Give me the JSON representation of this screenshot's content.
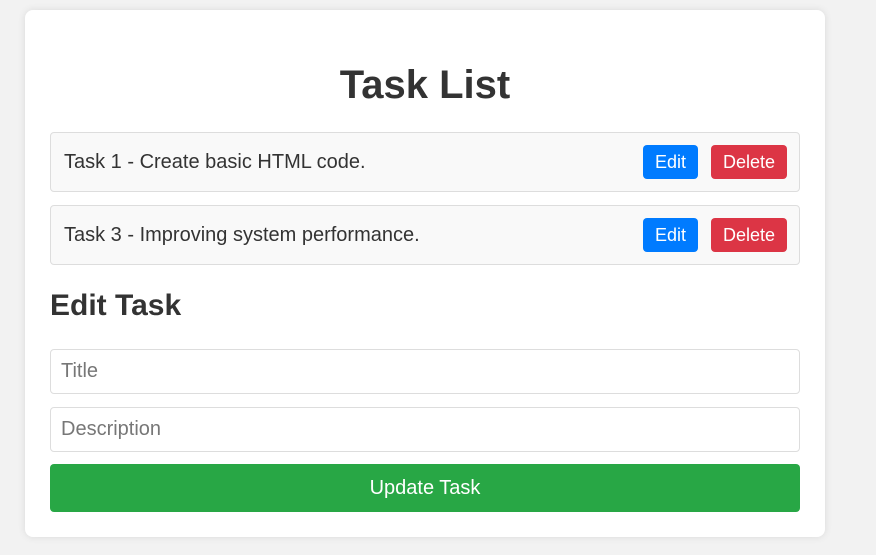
{
  "header": {
    "title": "Task List"
  },
  "tasks": [
    {
      "text": "Task 1 - Create basic HTML code.",
      "edit_label": "Edit",
      "delete_label": "Delete"
    },
    {
      "text": "Task 3 - Improving system performance.",
      "edit_label": "Edit",
      "delete_label": "Delete"
    }
  ],
  "edit_form": {
    "heading": "Edit Task",
    "title_value": "",
    "title_placeholder": "Title",
    "description_value": "",
    "description_placeholder": "Description",
    "submit_label": "Update Task"
  },
  "colors": {
    "edit_button": "#007bff",
    "delete_button": "#dc3545",
    "update_button": "#28a745"
  }
}
